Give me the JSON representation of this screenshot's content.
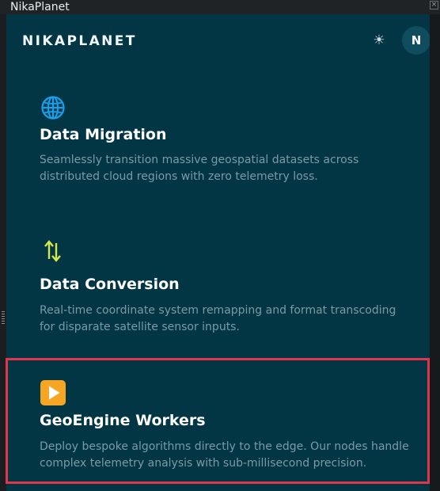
{
  "window": {
    "title": "NikaPlanet",
    "close_glyph": "×"
  },
  "header": {
    "brand": "NIKAPLANET",
    "theme_toggle_icon": "sun-icon",
    "theme_toggle_glyph": "☀",
    "avatar_initial": "N"
  },
  "colors": {
    "app_background": "#023645",
    "title_text": "#ffffff",
    "description_text": "#7c9aa5",
    "highlight_border": "#e0354c",
    "globe_icon": "#1a9fe8",
    "arrows_icon": "#d7e84a",
    "play_icon": "#f5a623"
  },
  "cards": [
    {
      "icon": "globe-icon",
      "title": "Data Migration",
      "description": "Seamlessly transition massive geospatial datasets across distributed cloud regions with zero telemetry loss."
    },
    {
      "icon": "up-down-arrows-icon",
      "title": "Data Conversion",
      "description": "Real-time coordinate system remapping and format transcoding for disparate satellite sensor inputs."
    },
    {
      "icon": "play-button-icon",
      "title": "GeoEngine Workers",
      "description": "Deploy bespoke algorithms directly to the edge. Our nodes handle complex telemetry analysis with sub-millisecond precision.",
      "highlighted": true
    }
  ]
}
